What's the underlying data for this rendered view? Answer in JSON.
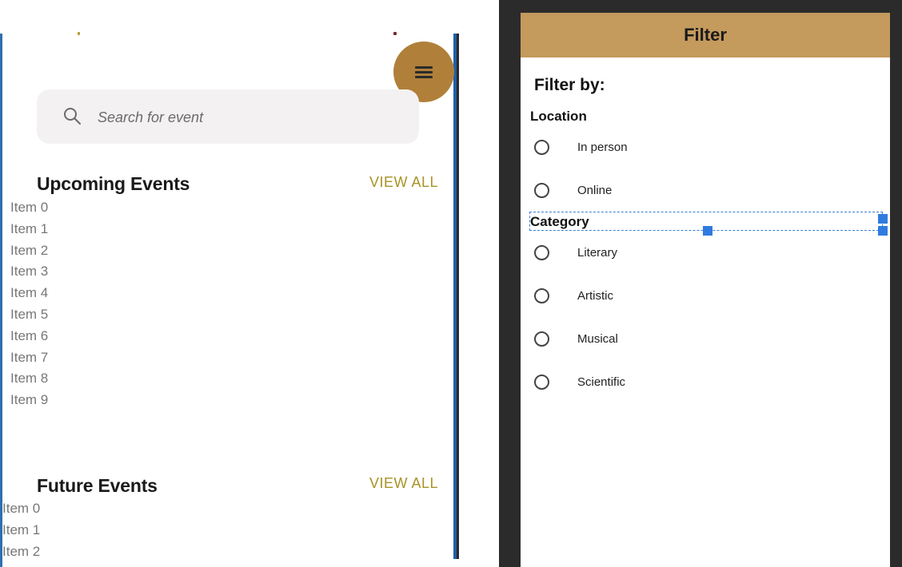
{
  "search": {
    "placeholder": "Search for event"
  },
  "upcoming": {
    "title": "Upcoming Events",
    "view_all": "VIEW ALL",
    "items": [
      "Item 0",
      "Item 1",
      "Item 2",
      "Item 3",
      "Item 4",
      "Item 5",
      "Item 6",
      "Item 7",
      "Item 8",
      "Item 9"
    ]
  },
  "future": {
    "title": "Future Events",
    "view_all": "VIEW ALL",
    "items": [
      "Item 0",
      "Item 1",
      "Item 2"
    ]
  },
  "filter": {
    "title": "Filter",
    "filter_by": "Filter by:",
    "location": {
      "label": "Location",
      "options": [
        "In person",
        "Online"
      ]
    },
    "category": {
      "label": "Category",
      "options": [
        "Literary",
        "Artistic",
        "Musical",
        "Scientific"
      ]
    }
  },
  "icons": {
    "menu": "menu-icon",
    "search": "search-icon",
    "radio": "radio-unchecked-icon"
  },
  "colors": {
    "fab": "#b0803a",
    "header": "#c49a5d",
    "view_all": "#a79326",
    "selection": "#3b7fd3"
  }
}
